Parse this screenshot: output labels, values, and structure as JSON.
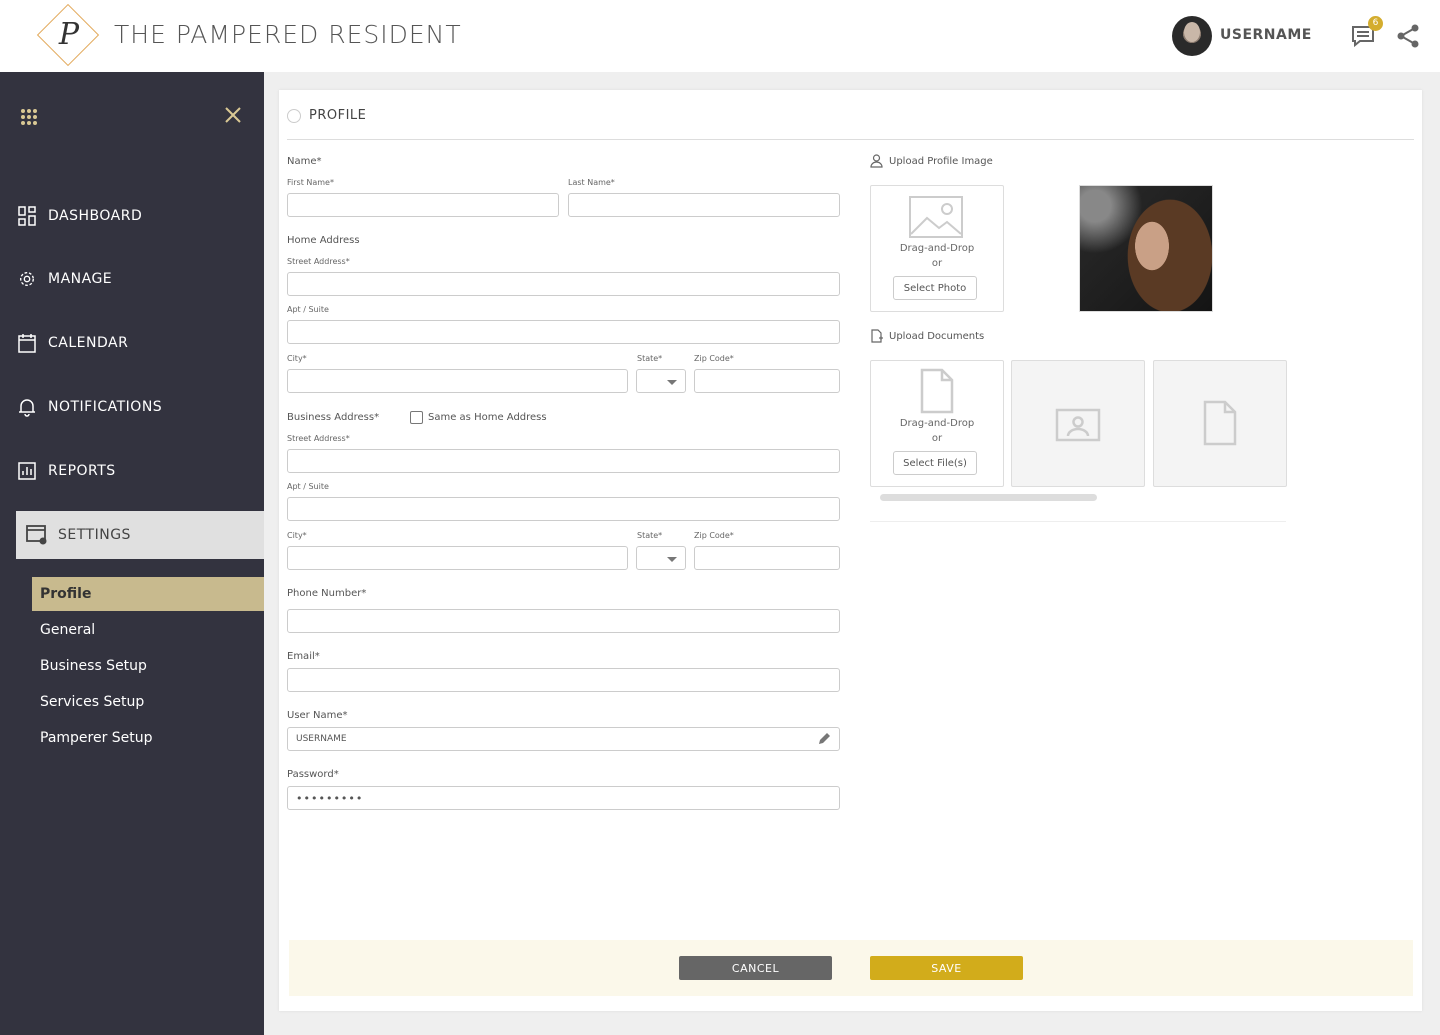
{
  "header": {
    "logo_letter": "P",
    "brand": "THE PAMPERED RESIDENT",
    "username": "USERNAME",
    "message_badge": "6"
  },
  "sidebar": {
    "nav": [
      {
        "label": "DASHBOARD",
        "icon": "dashboard-icon"
      },
      {
        "label": "MANAGE",
        "icon": "gear-icon"
      },
      {
        "label": "CALENDAR",
        "icon": "calendar-icon"
      },
      {
        "label": "NOTIFICATIONS",
        "icon": "bell-icon"
      },
      {
        "label": "REPORTS",
        "icon": "reports-icon"
      }
    ],
    "settings_label": "SETTINGS",
    "sub_items": [
      "Profile",
      "General",
      "Business Setup",
      "Services Setup",
      "Pamperer Setup"
    ],
    "active_sub": "Profile"
  },
  "profile": {
    "title": "PROFILE",
    "name_label": "Name*",
    "first_name_label": "First Name*",
    "last_name_label": "Last Name*",
    "home_address_label": "Home Address",
    "street_label": "Street Address*",
    "apt_label": "Apt / Suite",
    "city_label": "City*",
    "state_label": "State*",
    "zip_label": "Zip Code*",
    "business_address_label": "Business Address*",
    "same_as_home_label": "Same as Home Address",
    "phone_label": "Phone Number*",
    "email_label": "Email*",
    "username_label": "User Name*",
    "username_value": "USERNAME",
    "password_label": "Password*",
    "password_value": "•••••••••"
  },
  "uploads": {
    "profile_image_label": "Upload Profile Image",
    "drag_drop": "Drag-and-Drop",
    "or": "or",
    "select_photo": "Select Photo",
    "documents_label": "Upload Documents",
    "select_files": "Select File(s)"
  },
  "footer": {
    "cancel": "CANCEL",
    "save": "SAVE"
  },
  "colors": {
    "sidebar_bg": "#33333f",
    "accent_gold": "#d2ac1b",
    "active_sub_bg": "#c8ba8e",
    "footer_bg": "#fbf8ea"
  }
}
